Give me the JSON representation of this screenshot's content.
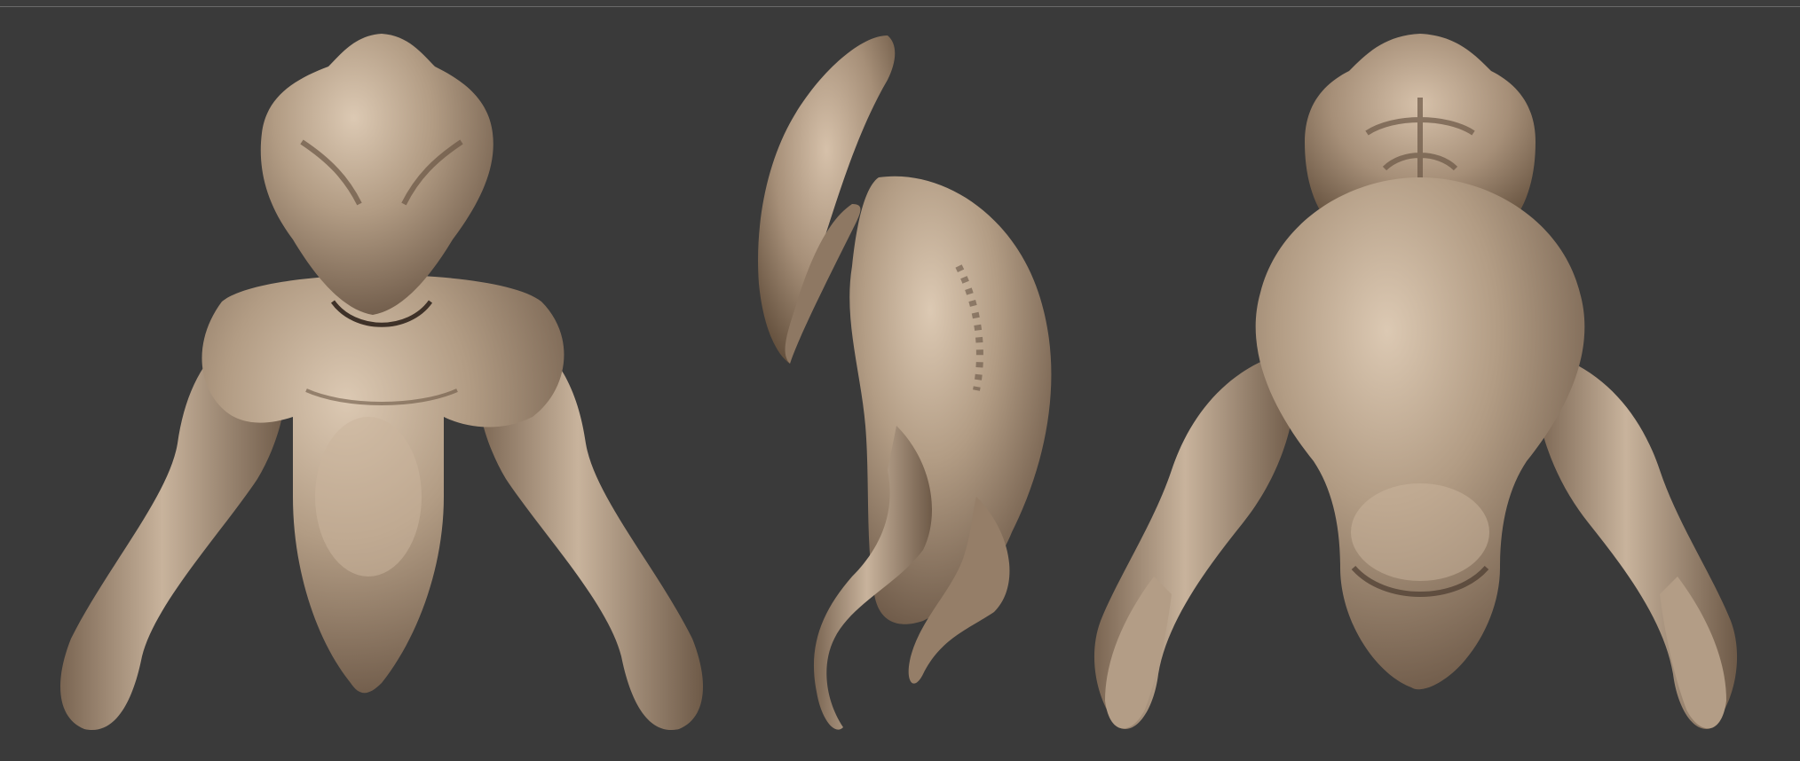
{
  "viewport": {
    "background_color": "#3a3a3a",
    "edge_line_color": "#6a6a6a"
  },
  "sculpt": {
    "material_color": "#a8917a",
    "highlight_color": "#d7c3ad",
    "shadow_color": "#5e4d3e",
    "views": [
      {
        "name": "front-view"
      },
      {
        "name": "side-view"
      },
      {
        "name": "back-view"
      }
    ]
  }
}
